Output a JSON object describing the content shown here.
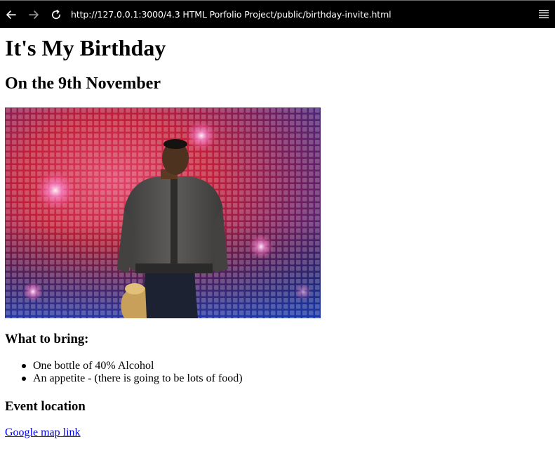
{
  "browser": {
    "url": "http://127.0.0.1:3000/4.3 HTML Porfolio Project/public/birthday-invite.html",
    "icons": {
      "back": "arrow-left-icon",
      "forward": "arrow-right-icon",
      "reload": "reload-icon",
      "menu": "hamburger-menu-icon"
    }
  },
  "page": {
    "title": "It's My Birthday",
    "subtitle": "On the 9th November",
    "photo": {
      "description_icon": "portrait-photo"
    },
    "bring_heading": "What to bring:",
    "bring_items": [
      "One bottle of 40% Alcohol",
      "An appetite - (there is going to be lots of food)"
    ],
    "location_heading": "Event location",
    "map_link_text": "Google map link"
  },
  "colors": {
    "browser_bar": "#000000",
    "link": "#0000ee",
    "background": "#ffffff"
  }
}
